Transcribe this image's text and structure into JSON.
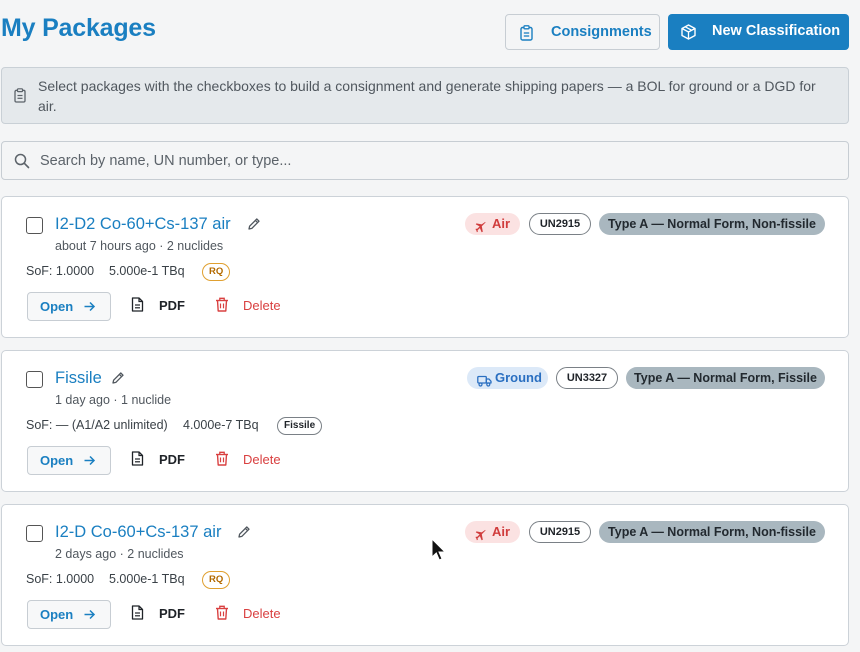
{
  "page": {
    "title": "My Packages"
  },
  "header": {
    "consignments_label": "Consignments",
    "new_classification_label": "New Classification"
  },
  "info": {
    "text": "Select packages with the checkboxes to build a consignment and generate shipping papers — a BOL for ground or a DGD for air."
  },
  "search": {
    "placeholder": "Search by name, UN number, or type..."
  },
  "packages": [
    {
      "name": "I2-D2 Co-60+Cs-137 air",
      "meta": "about 7 hours ago · 2 nuclides",
      "sof": "SoF: 1.0000",
      "activity": "5.000e-1 TBq",
      "badge": "RQ",
      "mode": "Air",
      "un": "UN2915",
      "type": "Type A — Normal Form, Non-fissile",
      "open_label": "Open",
      "pdf_label": "PDF",
      "delete_label": "Delete"
    },
    {
      "name": "Fissile",
      "meta": "1 day ago · 1 nuclide",
      "sof": "SoF: — (A1/A2 unlimited)",
      "activity": "4.000e-7 TBq",
      "badge": "Fissile",
      "mode": "Ground",
      "un": "UN3327",
      "type": "Type A — Normal Form, Fissile",
      "open_label": "Open",
      "pdf_label": "PDF",
      "delete_label": "Delete"
    },
    {
      "name": "I2-D Co-60+Cs-137 air",
      "meta": "2 days ago · 2 nuclides",
      "sof": "SoF: 1.0000",
      "activity": "5.000e-1 TBq",
      "badge": "RQ",
      "mode": "Air",
      "un": "UN2915",
      "type": "Type A — Normal Form, Non-fissile",
      "open_label": "Open",
      "pdf_label": "PDF",
      "delete_label": "Delete"
    }
  ],
  "icons": {
    "consignments": "clipboard-icon",
    "new_classification": "package-icon",
    "info": "clipboard-icon",
    "search": "search-icon",
    "edit": "pencil-icon",
    "open": "arrow-right-icon",
    "pdf": "document-icon",
    "delete": "trash-icon",
    "air": "plane-icon",
    "ground": "truck-icon"
  },
  "colors": {
    "accent": "#1a7fc1",
    "danger": "#d94040",
    "air_bg": "#fbe2e2",
    "ground_bg": "#dce9f8",
    "type_bg": "#a9b7bf"
  }
}
